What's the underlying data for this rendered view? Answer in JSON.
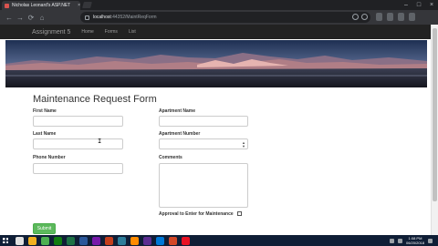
{
  "browser": {
    "tab_title": "Nicholas Leonard's ASP.NET",
    "tab_close": "×",
    "url_host": "localhost",
    "url_path": ":44352/MaintReqForm",
    "back_icon": "arrow-left-icon",
    "forward_icon": "arrow-right-icon",
    "reload_icon": "reload-icon",
    "home_icon": "home-icon",
    "window_controls": [
      "–",
      "□",
      "×"
    ]
  },
  "navbar": {
    "brand": "Assignment 5",
    "links": [
      "Home",
      "Forms",
      "List"
    ],
    "background": "#222222"
  },
  "form": {
    "title": "Maintenance Request Form",
    "first_name_label": "First Name",
    "last_name_label": "Last Name",
    "phone_label": "Phone Number",
    "apartment_name_label": "Apartment Name",
    "apartment_number_label": "Apartment Number",
    "comments_label": "Comments",
    "approval_label": "Approval to Enter for Maintenance",
    "submit_label": "Submit",
    "submit_color": "#5cb85c"
  },
  "taskbar": {
    "time": "1:08 PM",
    "date": "06/20/2018",
    "background": "#0f1e36",
    "app_colors": [
      "#e0e0e0",
      "#f2b01e",
      "#4caf50",
      "#107c10",
      "#1e7145",
      "#2b579a",
      "#7719aa",
      "#c43e1c",
      "#2d7d9a",
      "#ff8c00",
      "#5c2d91",
      "#0078d7",
      "#d24726",
      "#e81123"
    ]
  }
}
